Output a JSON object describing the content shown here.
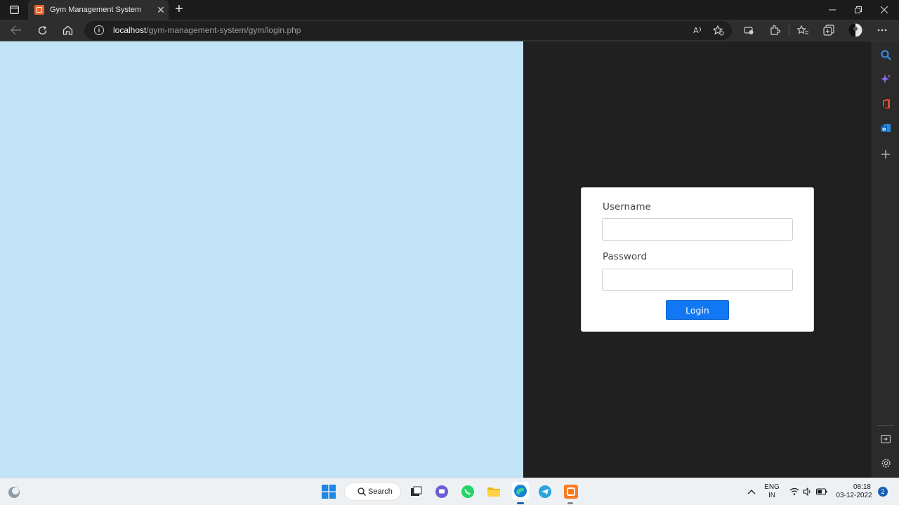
{
  "browser": {
    "tab_title": "Gym Management System",
    "tab_close": "✕",
    "new_tab": "+",
    "url_host": "localhost",
    "url_path": "/gym-management-system/gym/login.php",
    "info_glyph": "i"
  },
  "login": {
    "username_label": "Username",
    "username_value": "",
    "password_label": "Password",
    "password_value": "",
    "button_label": "Login"
  },
  "taskbar": {
    "search_label": "Search",
    "lang_top": "ENG",
    "lang_bottom": "IN",
    "time": "08:18",
    "date": "03-12-2022",
    "notification_count": "2"
  },
  "colors": {
    "left_panel": "#c2e2f6",
    "right_panel": "#202020",
    "login_button": "#1177f2"
  },
  "icons": {
    "tab_actions": "tab-actions-icon",
    "back": "back-arrow-icon",
    "refresh": "refresh-icon",
    "home": "home-icon",
    "read_aloud": "read-aloud-icon",
    "favorite": "add-favorite-icon",
    "extensions": "extensions-icon",
    "favorites": "favorites-icon",
    "collections": "collections-icon",
    "profile": "profile-avatar",
    "more": "more-icon"
  }
}
